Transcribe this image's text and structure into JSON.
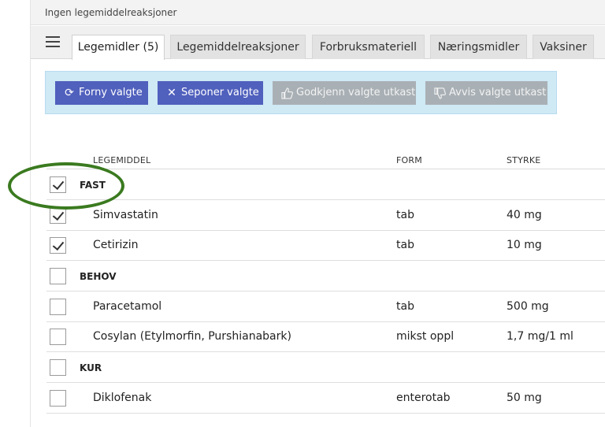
{
  "banner": {
    "text": "Ingen legemiddelreaksjoner"
  },
  "tabs": [
    {
      "label": "Legemidler (5)",
      "active": true
    },
    {
      "label": "Legemiddelreaksjoner",
      "active": false
    },
    {
      "label": "Forbruksmateriell",
      "active": false
    },
    {
      "label": "Næringsmidler",
      "active": false
    },
    {
      "label": "Vaksiner",
      "active": false
    }
  ],
  "actions": {
    "renew": {
      "label": "Forny valgte",
      "icon": "refresh-icon",
      "enabled": true
    },
    "discontinue": {
      "label": "Seponer valgte",
      "icon": "close-icon",
      "enabled": true
    },
    "approve": {
      "label": "Godkjenn valgte utkast",
      "icon": "thumbs-up-icon",
      "enabled": false
    },
    "reject": {
      "label": "Avvis valgte utkast",
      "icon": "thumbs-down-icon",
      "enabled": false
    }
  },
  "table": {
    "columns": [
      "LEGEMIDDEL",
      "FORM",
      "STYRKE"
    ],
    "groups": [
      {
        "label": "FAST",
        "checked": true,
        "rows": [
          {
            "name": "Simvastatin",
            "form": "tab",
            "strength": "40 mg",
            "checked": true
          },
          {
            "name": "Cetirizin",
            "form": "tab",
            "strength": "10 mg",
            "checked": true
          }
        ]
      },
      {
        "label": "BEHOV",
        "checked": false,
        "rows": [
          {
            "name": "Paracetamol",
            "form": "tab",
            "strength": "500 mg",
            "checked": false
          },
          {
            "name": "Cosylan (Etylmorfin, Purshianabark)",
            "form": "mikst oppl",
            "strength": "1,7 mg/1 ml",
            "checked": false
          }
        ]
      },
      {
        "label": "KUR",
        "checked": false,
        "rows": [
          {
            "name": "Diklofenak",
            "form": "enterotab",
            "strength": "50 mg",
            "checked": false
          }
        ]
      }
    ]
  },
  "annotation": {
    "color": "#3a7a1f"
  }
}
